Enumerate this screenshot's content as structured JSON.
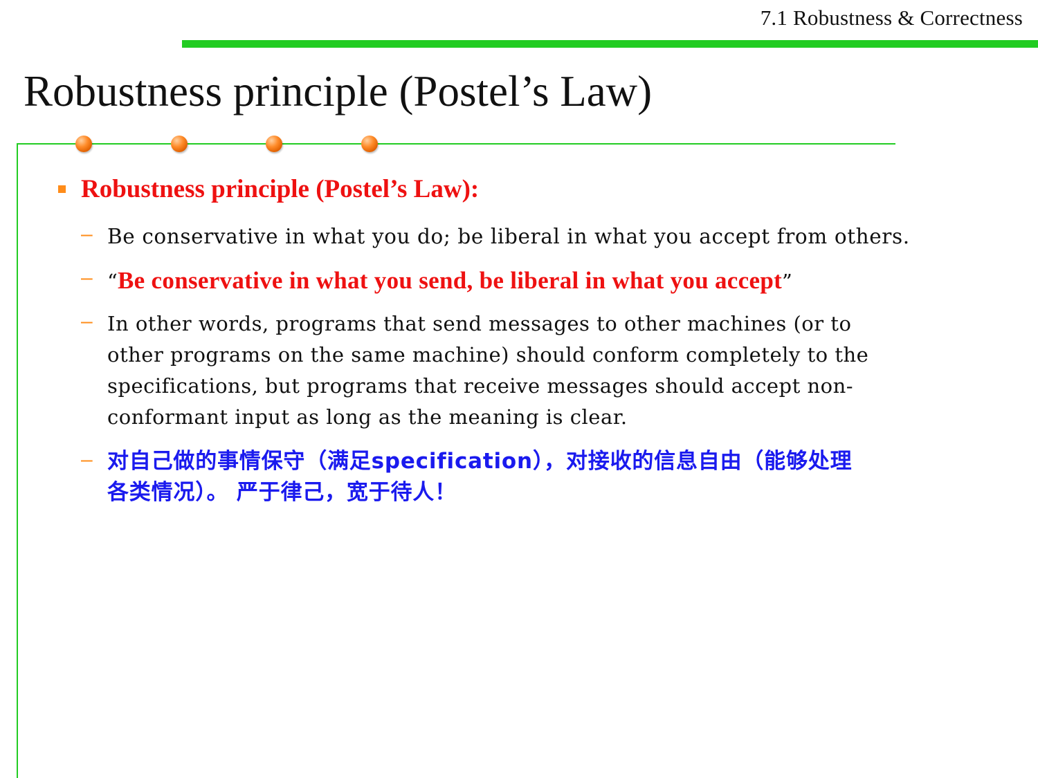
{
  "header": {
    "section": "7.1 Robustness & Correctness"
  },
  "slide": {
    "title": "Robustness principle (Postel’s Law)",
    "bullet": {
      "heading": "Robustness principle (Postel’s Law):",
      "items": [
        {
          "text": "Be conservative in what you do; be liberal in what you accept from others."
        },
        {
          "open_quote": "“",
          "emphasis": "Be conservative in what you send, be liberal in what you accept",
          "close_quote": "”"
        },
        {
          "lines": [
            "In other words, programs that send messages to other machines (or to",
            "other programs on the same machine) should conform completely to the",
            "specifications, but programs that receive messages should accept non-",
            "conformant input as long as the meaning is clear."
          ]
        },
        {
          "lines": [
            "对自己做的事情保守（满足specification），对接收的信息自由（能够处理",
            "各类情况）。 严于律己，宽于待人！"
          ]
        }
      ],
      "dash": "–"
    }
  },
  "colors": {
    "accent_green": "#22cc22",
    "heading_red": "#ee1111",
    "bullet_orange": "#ff8c1a",
    "chinese_blue": "#1a1aee"
  }
}
